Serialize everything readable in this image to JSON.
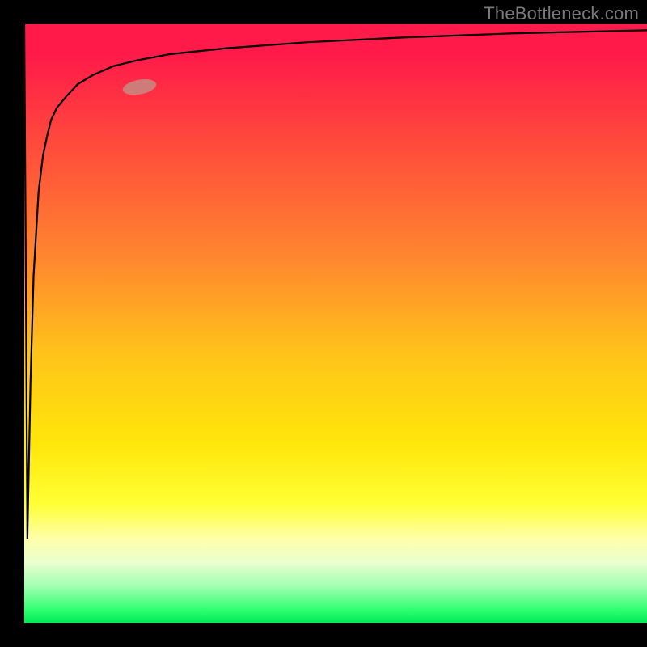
{
  "attribution": "TheBottleneck.com",
  "chart_data": {
    "type": "line",
    "title": "",
    "xlabel": "",
    "ylabel": "",
    "xlim": [
      0,
      100
    ],
    "ylim": [
      0,
      100
    ],
    "x": [
      0.0,
      0.2,
      0.5,
      1.0,
      1.5,
      2.3,
      3.0,
      3.6,
      4.3,
      5.2,
      6.8,
      8.6,
      11.0,
      14.3,
      18.2,
      23.4,
      32.5,
      45.5,
      61.0,
      79.0,
      100.0
    ],
    "values": [
      100.0,
      68.0,
      14.0,
      40.0,
      58.0,
      72.0,
      78.0,
      81.0,
      84.0,
      86.0,
      88.0,
      90.0,
      91.5,
      93.0,
      94.0,
      95.0,
      96.0,
      97.0,
      97.8,
      98.5,
      99.0
    ],
    "marker": {
      "x": 18.5,
      "y": 89.5
    },
    "gradient": {
      "top_color": "#ff1a49",
      "bottom_color": "#00e85b"
    }
  }
}
